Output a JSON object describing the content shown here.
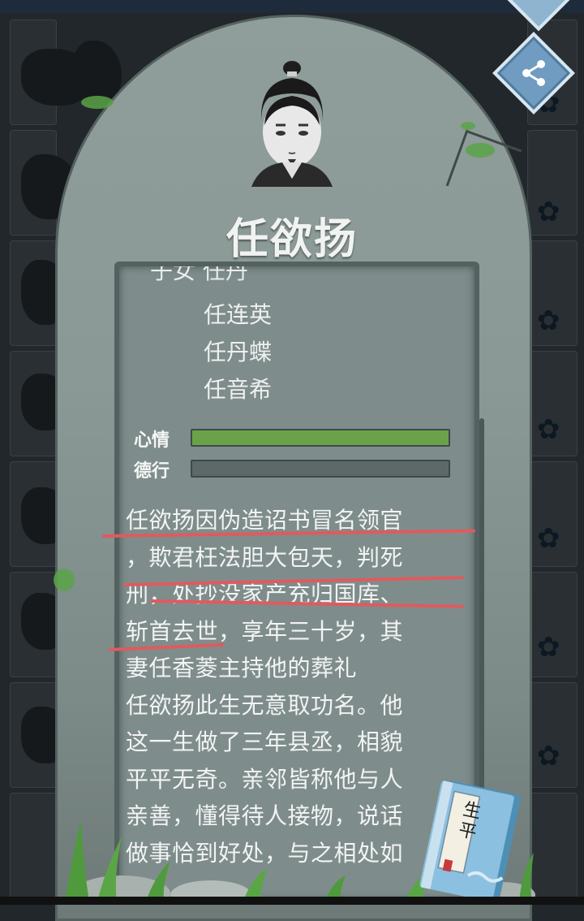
{
  "character": {
    "name": "任欲扬",
    "children_label_partial": "子女 任丹",
    "children": [
      "任连英",
      "任丹蝶",
      "任音希"
    ]
  },
  "stats": {
    "mood_label": "心情",
    "mood_level": 1.0,
    "virtue_label": "德行",
    "virtue_level": 0.0
  },
  "biography": {
    "lines": [
      "任欲扬因伪造诏书冒名领官",
      "，欺君枉法胆大包天，判死",
      "刑，处抄没家产充归国库、",
      "斩首去世，享年三十岁，其",
      "妻任香菱主持他的葬礼",
      "任欲扬此生无意取功名。他",
      "这一生做了三年县丞，相貌",
      "平平无奇。亲邻皆称他与人",
      "亲善，懂得待人接物，说话",
      "做事恰到好处，与之相处如"
    ]
  },
  "book": {
    "title": "生平"
  },
  "colors": {
    "mood_bar": "#6aa24a",
    "virtue_bar": "#6d7d7b",
    "stone": "#8a9896",
    "annotation": "#e05a5f",
    "share_button": "#6f9cc0"
  },
  "icons": {
    "share": "share-icon",
    "menu_diamond": "diamond-icon",
    "book": "book-icon",
    "flower": "plum-flower-icon"
  }
}
